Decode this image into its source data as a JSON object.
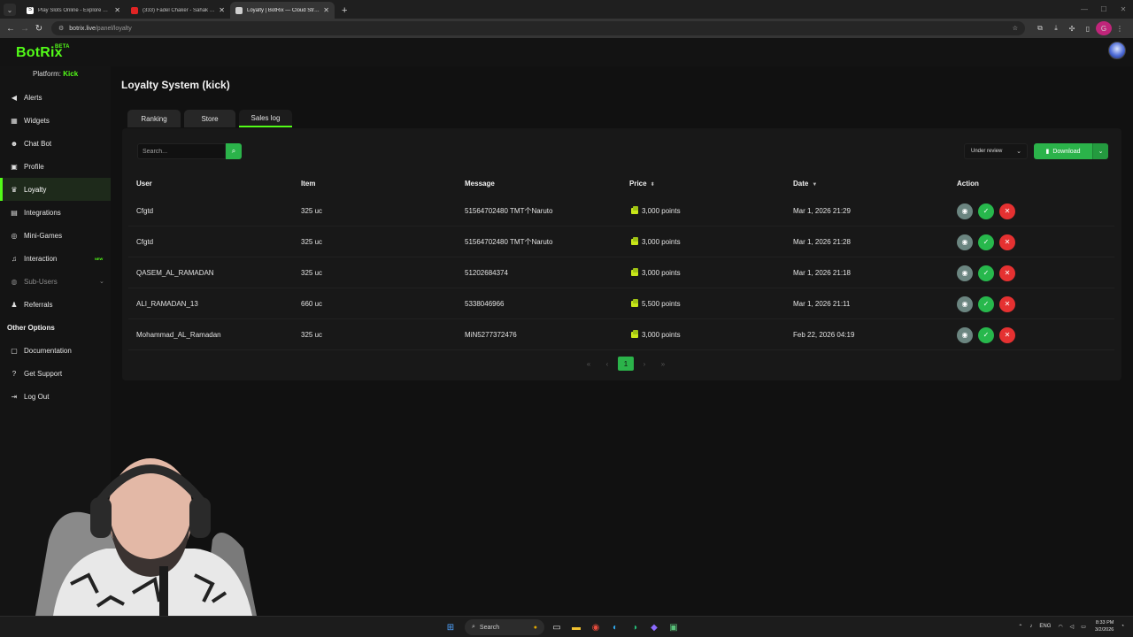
{
  "browser": {
    "tabs": [
      {
        "title": "Play Slots Online - Explore 460...",
        "favicon_color": "#ffffff",
        "favicon": "S"
      },
      {
        "title": "(333) Fadel Chaker - Sahak Is...",
        "favicon_color": "#e02424",
        "favicon": ""
      },
      {
        "title": "Loyalty | BotRix — Cloud Strea...",
        "favicon_color": "#cfcfcf",
        "favicon": ""
      }
    ],
    "url_host": "botrix.live",
    "url_path": "/panel/loyalty",
    "profile_initial": "G"
  },
  "app": {
    "logo": "BotRix",
    "logo_badge": "BETA",
    "platform_label": "Platform:",
    "platform_value": "Kick",
    "brand_color": "#53fc18"
  },
  "sidebar": {
    "items": [
      {
        "label": "Alerts",
        "icon": "alert-icon",
        "glyph": "◀"
      },
      {
        "label": "Widgets",
        "icon": "widgets-icon",
        "glyph": "▦"
      },
      {
        "label": "Chat Bot",
        "icon": "robot-icon",
        "glyph": "☻"
      },
      {
        "label": "Profile",
        "icon": "profile-card-icon",
        "glyph": "▣"
      },
      {
        "label": "Loyalty",
        "icon": "trophy-icon",
        "glyph": "♛"
      },
      {
        "label": "Integrations",
        "icon": "integrations-icon",
        "glyph": "▤"
      },
      {
        "label": "Mini-Games",
        "icon": "gamepad-icon",
        "glyph": "◎"
      },
      {
        "label": "Interaction",
        "icon": "music-icon",
        "glyph": "♫",
        "badge": "NEW"
      },
      {
        "label": "Sub-Users",
        "icon": "users-icon",
        "glyph": "◍"
      },
      {
        "label": "Referrals",
        "icon": "referrals-icon",
        "glyph": "♟"
      }
    ],
    "other_heading": "Other Options",
    "other_items": [
      {
        "label": "Documentation",
        "icon": "document-icon",
        "glyph": "▢"
      },
      {
        "label": "Get Support",
        "icon": "question-icon",
        "glyph": "?"
      },
      {
        "label": "Log Out",
        "icon": "logout-icon",
        "glyph": "⇥"
      }
    ]
  },
  "main": {
    "title": "Loyalty System (kick)",
    "tabs": [
      "Ranking",
      "Store",
      "Sales log"
    ],
    "search_placeholder": "Search...",
    "filter_value": "Under review",
    "download_label": "Download",
    "columns": [
      "User",
      "Item",
      "Message",
      "Price",
      "Date",
      "Action"
    ],
    "rows": [
      {
        "user": "Cfgtd",
        "item": "325 uc",
        "message": "51564702480 TMT个Naruto",
        "price": "3,000 points",
        "date": "Mar 1, 2026 21:29"
      },
      {
        "user": "Cfgtd",
        "item": "325 uc",
        "message": "51564702480 TMT个Naruto",
        "price": "3,000 points",
        "date": "Mar 1, 2026 21:28"
      },
      {
        "user": "QASEM_AL_RAMADAN",
        "item": "325 uc",
        "message": "51202684374",
        "price": "3,000 points",
        "date": "Mar 1, 2026 21:18"
      },
      {
        "user": "ALI_RAMADAN_13",
        "item": "660 uc",
        "message": "5338046966",
        "price": "5,500 points",
        "date": "Mar 1, 2026 21:11"
      },
      {
        "user": "Mohammad_AL_Ramadan",
        "item": "325 uc",
        "message": "MiN5277372476",
        "price": "3,000 points",
        "date": "Feb 22, 2026 04:19"
      }
    ],
    "pagination": {
      "first": "«",
      "prev": "‹",
      "current": "1",
      "next": "›",
      "last": "»"
    }
  },
  "taskbar": {
    "search_label": "Search",
    "lang": "ENG",
    "time": "8:33 PM",
    "date": "3/2/2026"
  }
}
